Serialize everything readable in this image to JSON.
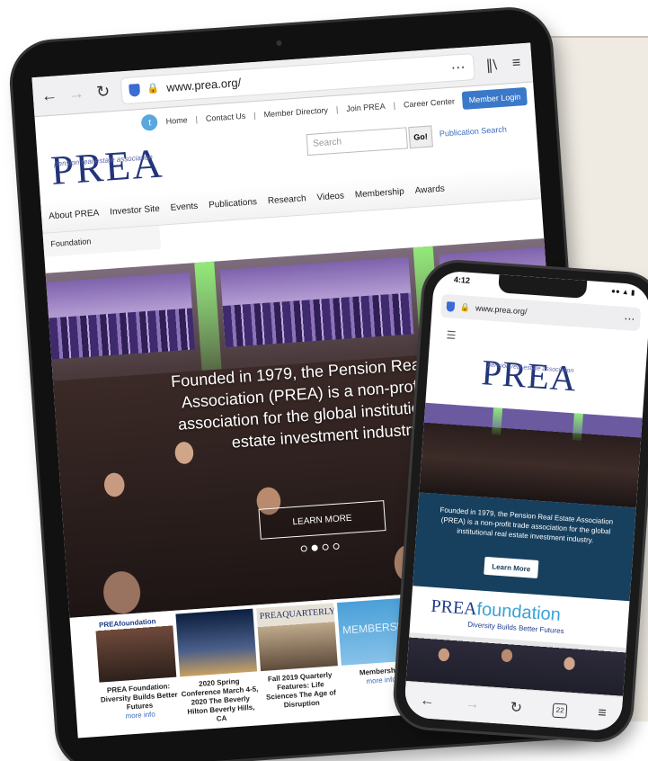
{
  "tablet": {
    "url": "www.prea.org/",
    "utility_links": [
      "Home",
      "Contact Us",
      "Member Directory",
      "Join PREA",
      "Career Center"
    ],
    "member_login": "Member Login",
    "logo": "PREA",
    "logo_tagline": "pension real estate association",
    "search_placeholder": "Search",
    "go_label": "Go!",
    "publication_search": "Publication Search",
    "menu": [
      "About PREA",
      "Investor Site",
      "Events",
      "Publications",
      "Research",
      "Videos",
      "Membership",
      "Awards"
    ],
    "submenu": "Foundation",
    "hero_text": "Founded in 1979, the Pension Real Estate Association (PREA) is a non-profit trade association for the global institutional real estate investment industry.",
    "learn_more": "LEARN MORE",
    "carousel": {
      "count": 4,
      "active": 2
    },
    "cards": [
      {
        "thumb_label": "PREAfoundation",
        "caption": "PREA Foundation: Diversity Builds Better Futures",
        "more": "more info"
      },
      {
        "thumb_label": "",
        "caption": "2020 Spring Conference March 4-5, 2020 The Beverly Hilton Beverly Hills, CA",
        "more": ""
      },
      {
        "thumb_label": "PREAQUARTERLY",
        "caption": "Fall 2019 Quarterly Features: Life Sciences The Age of Disruption",
        "more": ""
      },
      {
        "thumb_label": "MEMBERSHIP",
        "caption": "Membership",
        "more": "more info"
      }
    ]
  },
  "phone": {
    "time": "4:12",
    "url": "www.prea.org/",
    "logo": "PREA",
    "logo_tagline": "pension real estate association",
    "hero_text": "Founded in 1979, the Pension Real Estate Association (PREA) is a non-profit trade association for the global institutional real estate investment industry.",
    "learn_more": "Learn More",
    "foundation_logo_prefix": "PREA",
    "foundation_logo_word": "foundation",
    "foundation_tagline": "Diversity Builds Better Futures",
    "tab_count": "22"
  },
  "colors": {
    "brand_navy": "#23357a",
    "link_blue": "#3a6bbd",
    "phone_banner": "#17405e",
    "login_blue": "#3a78c8"
  }
}
